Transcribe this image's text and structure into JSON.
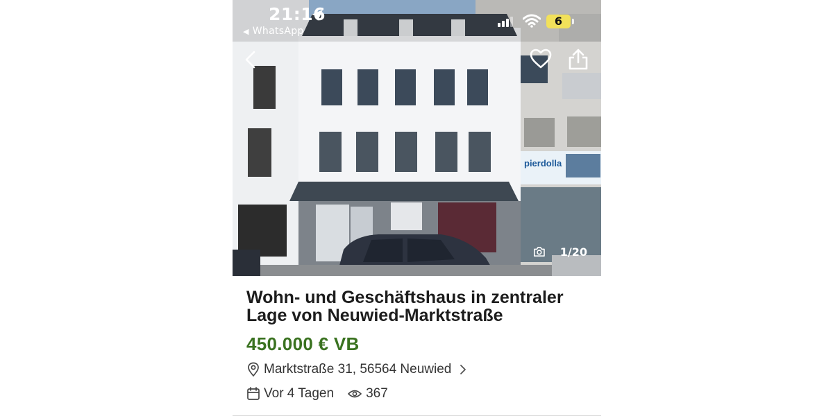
{
  "status_bar": {
    "time": "21:16",
    "back_app": "WhatsApp",
    "battery": "6"
  },
  "gallery": {
    "counter": "1/20",
    "sign_text": "pierdolla"
  },
  "listing": {
    "title": "Wohn- und Geschäftshaus in zentraler Lage von Neuwied-Marktstraße",
    "price": "450.000 € VB",
    "address": "Marktstraße 31, 56564 Neuwied",
    "posted": "Vor 4 Tagen",
    "views": "367"
  },
  "colors": {
    "price": "#3a7220",
    "text": "#333333",
    "battery": "#f2e15a"
  }
}
